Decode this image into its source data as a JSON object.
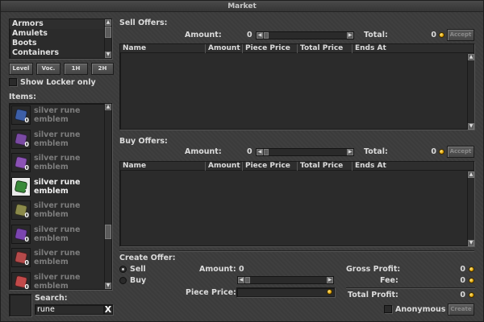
{
  "window": {
    "title": "Market"
  },
  "categories": {
    "items": [
      "Armors",
      "Amulets",
      "Boots",
      "Containers"
    ]
  },
  "filters": {
    "level_label": "Level",
    "voc_label": "Voc.",
    "one_hand_label": "1H",
    "two_hand_label": "2H",
    "show_locker_label": "Show Locker only"
  },
  "items_section": {
    "label": "Items:",
    "list": [
      {
        "name": "silver rune emblem",
        "count": "0",
        "color": "#3d5fa8",
        "active": false
      },
      {
        "name": "silver rune emblem",
        "count": "0",
        "color": "#7a4aa3",
        "active": false
      },
      {
        "name": "silver rune emblem",
        "count": "0",
        "color": "#8b52b5",
        "active": false
      },
      {
        "name": "silver rune emblem",
        "count": "1",
        "color": "#3a8a3a",
        "active": true
      },
      {
        "name": "silver rune emblem",
        "count": "0",
        "color": "#8b8a4a",
        "active": false
      },
      {
        "name": "silver rune emblem",
        "count": "0",
        "color": "#7b45b0",
        "active": false
      },
      {
        "name": "silver rune emblem",
        "count": "0",
        "color": "#b54a4a",
        "active": false
      },
      {
        "name": "silver rune emblem",
        "count": "0",
        "color": "#c24a4a",
        "active": false
      }
    ]
  },
  "search": {
    "label": "Search:",
    "value": "rune",
    "clear": "X"
  },
  "sell_offers": {
    "label": "Sell Offers:",
    "amount_label": "Amount:",
    "amount_value": "0",
    "total_label": "Total:",
    "total_value": "0",
    "accept_label": "Accept",
    "columns": [
      "Name",
      "Amount",
      "Piece Price",
      "Total Price",
      "Ends At"
    ]
  },
  "buy_offers": {
    "label": "Buy Offers:",
    "amount_label": "Amount:",
    "amount_value": "0",
    "total_label": "Total:",
    "total_value": "0",
    "accept_label": "Accept",
    "columns": [
      "Name",
      "Amount",
      "Piece Price",
      "Total Price",
      "Ends At"
    ]
  },
  "create_offer": {
    "label": "Create Offer:",
    "sell_label": "Sell",
    "buy_label": "Buy",
    "amount_label": "Amount:",
    "amount_value": "0",
    "piece_price_label": "Piece Price:",
    "gross_profit_label": "Gross Profit:",
    "gross_profit_value": "0",
    "fee_label": "Fee:",
    "fee_value": "0",
    "total_profit_label": "Total Profit:",
    "total_profit_value": "0",
    "anonymous_label": "Anonymous",
    "create_label": "Create"
  }
}
